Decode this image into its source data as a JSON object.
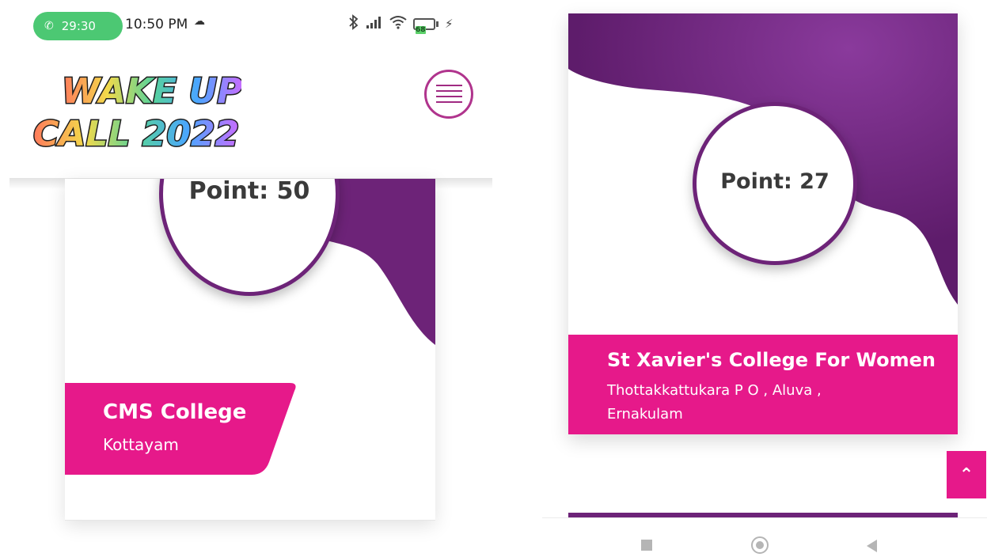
{
  "status_bar": {
    "call_timer": "29:30",
    "time": "10:50 PM",
    "battery": "68"
  },
  "header": {
    "logo_text_line1": "WAKE UP",
    "logo_text_line2": "CALL 2022"
  },
  "cards": [
    {
      "points_label": "Point: 50",
      "college_name": "CMS College",
      "location": "Kottayam"
    },
    {
      "points_label": "Point: 27",
      "college_name": "St Xavier's College For Women",
      "location": "Thottakkattukara P O , Aluva , Ernakulam"
    }
  ],
  "colors": {
    "brand_purple": "#6d2378",
    "accent_pink": "#e6198a",
    "menu_ring": "#b0348d",
    "call_green": "#4cc873"
  },
  "icons": {
    "call": "phone-icon",
    "cloud": "cloud-icon",
    "bluetooth": "bluetooth-icon",
    "signal": "signal-icon",
    "wifi": "wifi-icon",
    "battery": "battery-icon",
    "charging": "charging-icon",
    "menu": "hamburger-menu-icon",
    "scroll_top": "double-chevron-up-icon",
    "nav_recent": "recent-apps-icon",
    "nav_home": "home-icon",
    "nav_back": "back-icon"
  }
}
